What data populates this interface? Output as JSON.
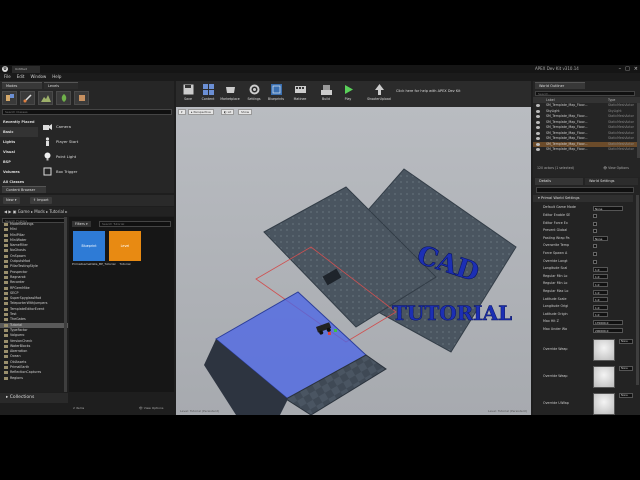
{
  "window": {
    "app_title": "APEX Dev Kit v310.14",
    "tab_label": "Untitled",
    "logo_letter": "U"
  },
  "menu": [
    "File",
    "Edit",
    "Window",
    "Help"
  ],
  "modes": {
    "tab_label": "Modes",
    "levels_tab_label": "Levels",
    "search_placeholder": "Search Classes",
    "categories": [
      "Recently Placed",
      "Basic",
      "Lights",
      "Visual",
      "BSP",
      "Volumes",
      "All Classes"
    ],
    "selected_category": "Basic",
    "placeables": [
      {
        "label": "Camera",
        "icon": "camera-icon"
      },
      {
        "label": "Player Start",
        "icon": "player-start-icon"
      },
      {
        "label": "Point Light",
        "icon": "point-light-icon"
      },
      {
        "label": "Box Trigger",
        "icon": "box-trigger-icon"
      }
    ]
  },
  "content_browser": {
    "tab_label": "Content Browser",
    "new_label": "New",
    "import_label": "Import",
    "path": [
      "Game",
      "Mods",
      "Tutorial"
    ],
    "search_folders_placeholder": "Search Folders",
    "filters_label": "Filters",
    "search_placeholder": "Search Tutorial",
    "folders": [
      "ModelSettings",
      "Mini",
      "MiniPillar",
      "MiniWater",
      "NameFilter",
      "NoGhosts",
      "OnSpawn",
      "OutputsMod",
      "PillarTestingStyle",
      "Prospector",
      "Ragnarok",
      "Recorder",
      "RPGemMike",
      "SECP",
      "SuperSpyglassMod",
      "TeleporterWithJumpers",
      "TemplateEditorEvent",
      "Test",
      "TheGates",
      "Tutorial",
      "TypeFactor",
      "Valguero",
      "VersionCheck",
      "WaterBlocks",
      "Aberration",
      "Ocean",
      "OldAssets",
      "PrimalEarth",
      "ReflectionCaptures",
      "Regions"
    ],
    "selected_folder": "Tutorial",
    "assets": [
      {
        "label": "PrimalGameData_BP_Tutorial",
        "tile_text": "Blueprint",
        "color": "#2e7bd6"
      },
      {
        "label": "Tutorial",
        "tile_text": "Level",
        "color": "#e88a12"
      }
    ],
    "collections_label": "Collections",
    "item_count": "2 items",
    "view_options_label": "View Options"
  },
  "toolbar": {
    "buttons": [
      "Save",
      "Content",
      "Marketplace",
      "Settings",
      "Blueprints",
      "Matinee",
      "Build",
      "Play",
      "ShooterUpload"
    ],
    "help_text": "Click here for help with APEX Dev Kit"
  },
  "viewport": {
    "perspective_label": "Perspective",
    "lit_label": "Lit",
    "show_label": "Show",
    "overlay_text_1": "CAD",
    "overlay_text_2": "TUTORIAL",
    "bottom_left_text": "Level: Tutorial (Persistent)",
    "bottom_right_text": "Level: Tutorial (Persistent)"
  },
  "outliner": {
    "tab_label": "World Outliner",
    "search_placeholder": "Search...",
    "col_label": "Label",
    "col_type": "Type",
    "rows": [
      {
        "name": "SM_Template_Map_Floor...",
        "type": "StaticMeshActor"
      },
      {
        "name": "SkyLight",
        "type": "SkyLight"
      },
      {
        "name": "SM_Template_Map_Floor...",
        "type": "StaticMeshActor"
      },
      {
        "name": "SM_Template_Map_Floor...",
        "type": "StaticMeshActor"
      },
      {
        "name": "SM_Template_Map_Floor...",
        "type": "StaticMeshActor"
      },
      {
        "name": "SM_Template_Map_Floor...",
        "type": "StaticMeshActor"
      },
      {
        "name": "SM_Template_Map_Floor...",
        "type": "StaticMeshActor"
      },
      {
        "name": "SM_Template_Map_Floor...",
        "type": "StaticMeshActor"
      },
      {
        "name": "SM_Template_Map_Floor...",
        "type": "StaticMeshActor"
      }
    ],
    "selected_index": 7,
    "status": "120 actors (1 selected)",
    "view_options_label": "View Options"
  },
  "details": {
    "tab_label": "Details",
    "world_settings_label": "World Settings",
    "section": "Primal World Settings",
    "default_game_mode_label": "Default Game Mode",
    "default_game_mode_value": "None",
    "rows": [
      {
        "label": "Editor Enable SE",
        "kind": "check"
      },
      {
        "label": "Editor Force Ex",
        "kind": "check"
      },
      {
        "label": "Prevent Global",
        "kind": "check"
      },
      {
        "label": "Pasting Wrap Pa",
        "kind": "value",
        "value": "None"
      },
      {
        "label": "Overwrite Temp",
        "kind": "check"
      },
      {
        "label": "Force Spawn A",
        "kind": "check"
      },
      {
        "label": "Override Longt",
        "kind": "check"
      },
      {
        "label": "Longitude Scal",
        "kind": "value",
        "value": "1.0"
      },
      {
        "label": "Regular Min Lo",
        "kind": "value",
        "value": "1.0"
      },
      {
        "label": "Regular Min Lo",
        "kind": "value",
        "value": "1.0"
      },
      {
        "label": "Regular Max Lo",
        "kind": "value",
        "value": "1.0"
      },
      {
        "label": "Latitude Scale",
        "kind": "value",
        "value": "1.0"
      },
      {
        "label": "Longitude Origi",
        "kind": "value",
        "value": "1.0"
      },
      {
        "label": "Latitude Origin",
        "kind": "value",
        "value": "1.0"
      },
      {
        "label": "Max Hit Z",
        "kind": "value",
        "value": "170000.0"
      },
      {
        "label": "Max Under Wa",
        "kind": "value",
        "value": "200000.0"
      }
    ],
    "overrides": [
      {
        "label": "Override Weap",
        "value": "None"
      },
      {
        "label": "Override Weap",
        "value": "None"
      },
      {
        "label": "Override UiWap",
        "value": "None"
      }
    ]
  }
}
